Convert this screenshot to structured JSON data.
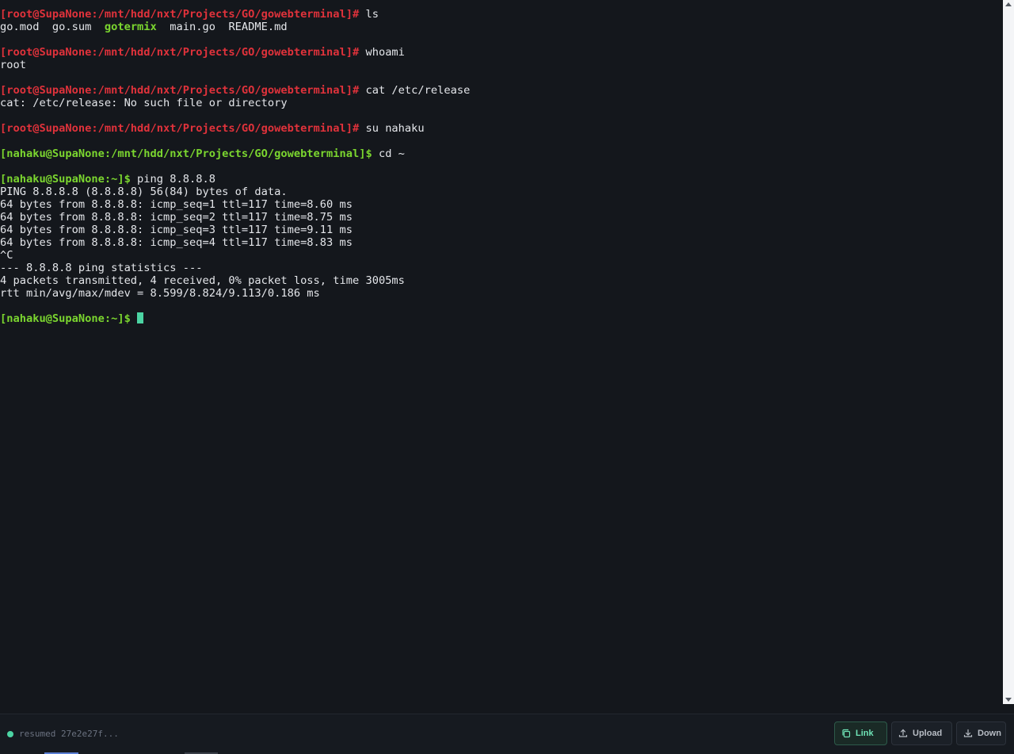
{
  "terminal": {
    "lines": [
      [
        {
          "t": "[root@SupaNone:/mnt/hdd/nxt/Projects/GO/gowebterminal]#",
          "c": "root"
        },
        {
          "t": " ls",
          "c": "plain"
        }
      ],
      [
        {
          "t": "go.mod  go.sum  ",
          "c": "plain"
        },
        {
          "t": "gotermix",
          "c": "dir"
        },
        {
          "t": "  main.go  README.md",
          "c": "plain"
        }
      ],
      [],
      [
        {
          "t": "[root@SupaNone:/mnt/hdd/nxt/Projects/GO/gowebterminal]#",
          "c": "root"
        },
        {
          "t": " whoami",
          "c": "plain"
        }
      ],
      [
        {
          "t": "root",
          "c": "plain"
        }
      ],
      [],
      [
        {
          "t": "[root@SupaNone:/mnt/hdd/nxt/Projects/GO/gowebterminal]#",
          "c": "root"
        },
        {
          "t": " cat /etc/release",
          "c": "plain"
        }
      ],
      [
        {
          "t": "cat: /etc/release: No such file or directory",
          "c": "plain"
        }
      ],
      [],
      [
        {
          "t": "[root@SupaNone:/mnt/hdd/nxt/Projects/GO/gowebterminal]#",
          "c": "root"
        },
        {
          "t": " su nahaku",
          "c": "plain"
        }
      ],
      [],
      [
        {
          "t": "[nahaku@SupaNone:/mnt/hdd/nxt/Projects/GO/gowebterminal]$",
          "c": "user"
        },
        {
          "t": " cd ~",
          "c": "plain"
        }
      ],
      [],
      [
        {
          "t": "[nahaku@SupaNone:~]$",
          "c": "user"
        },
        {
          "t": " ping 8.8.8.8",
          "c": "plain"
        }
      ],
      [
        {
          "t": "PING 8.8.8.8 (8.8.8.8) 56(84) bytes of data.",
          "c": "plain"
        }
      ],
      [
        {
          "t": "64 bytes from 8.8.8.8: icmp_seq=1 ttl=117 time=8.60 ms",
          "c": "plain"
        }
      ],
      [
        {
          "t": "64 bytes from 8.8.8.8: icmp_seq=2 ttl=117 time=8.75 ms",
          "c": "plain"
        }
      ],
      [
        {
          "t": "64 bytes from 8.8.8.8: icmp_seq=3 ttl=117 time=9.11 ms",
          "c": "plain"
        }
      ],
      [
        {
          "t": "64 bytes from 8.8.8.8: icmp_seq=4 ttl=117 time=8.83 ms",
          "c": "plain"
        }
      ],
      [
        {
          "t": "^C",
          "c": "plain"
        }
      ],
      [
        {
          "t": "--- 8.8.8.8 ping statistics ---",
          "c": "plain"
        }
      ],
      [
        {
          "t": "4 packets transmitted, 4 received, 0% packet loss, time 3005ms",
          "c": "plain"
        }
      ],
      [
        {
          "t": "rtt min/avg/max/mdev = 8.599/8.824/9.113/0.186 ms",
          "c": "plain"
        }
      ],
      [],
      [
        {
          "t": "[nahaku@SupaNone:~]$",
          "c": "user"
        },
        {
          "t": " ",
          "c": "plain"
        },
        {
          "t": "",
          "c": "cursor"
        }
      ]
    ]
  },
  "statusbar": {
    "status_text": "resumed 27e2e27f...",
    "status_color": "#4cd4a3",
    "buttons": {
      "link": {
        "label": "Link",
        "icon": "copy-icon"
      },
      "upload": {
        "label": "Upload",
        "icon": "upload-icon"
      },
      "down": {
        "label": "Down",
        "icon": "download-icon"
      }
    }
  },
  "colors": {
    "background": "#14171c",
    "root_prompt": "#e0323b",
    "user_prompt": "#7bd62f",
    "accent": "#4cd4a3"
  }
}
